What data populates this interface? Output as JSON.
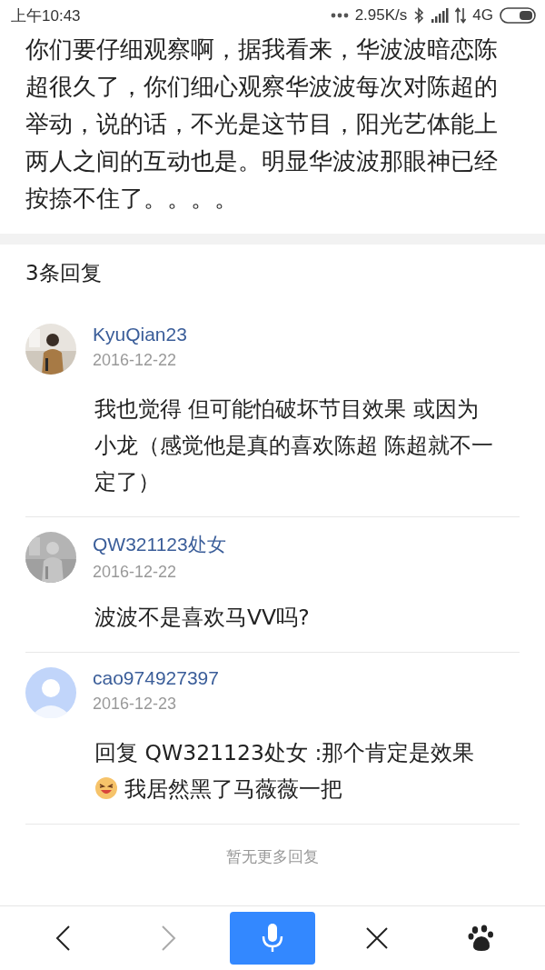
{
  "status_bar": {
    "time": "上午10:43",
    "speed": "2.95K/s",
    "network": "4G"
  },
  "post": {
    "text": "你们要仔细观察啊，据我看来，华波波暗恋陈超很久了，你们细心观察华波波每次对陈超的举动，说的话，不光是这节目，阳光艺体能上两人之间的互动也是。明显华波波那眼神已经按捺不住了。。。。"
  },
  "replies_header": "3条回复",
  "comments": [
    {
      "name": "KyuQian23",
      "date": "2016-12-22",
      "body": [
        {
          "kind": "text",
          "text": "我也觉得 但可能怕破坏节目效果 或因为小龙（感觉他是真的喜欢陈超 陈超就不一定了）"
        }
      ]
    },
    {
      "name": "QW321123处女",
      "date": "2016-12-22",
      "body": [
        {
          "kind": "text",
          "text": "波波不是喜欢马VV吗?"
        }
      ]
    },
    {
      "avatar": {
        "kind": "default"
      },
      "name": "cao974927397",
      "date": "2016-12-23",
      "body": [
        {
          "kind": "text",
          "text": "回复 QW321123处女 :那个肯定是效果"
        },
        {
          "kind": "emoji"
        },
        {
          "kind": "text",
          "text": " 我居然黑了马薇薇一把"
        }
      ]
    }
  ],
  "footer_note": "暂无更多回复",
  "toolbar": [
    {
      "kind": "back"
    },
    {
      "kind": "forward",
      "disabled": true
    },
    {
      "kind": "voice"
    },
    {
      "kind": "close"
    },
    {
      "kind": "paw"
    }
  ]
}
